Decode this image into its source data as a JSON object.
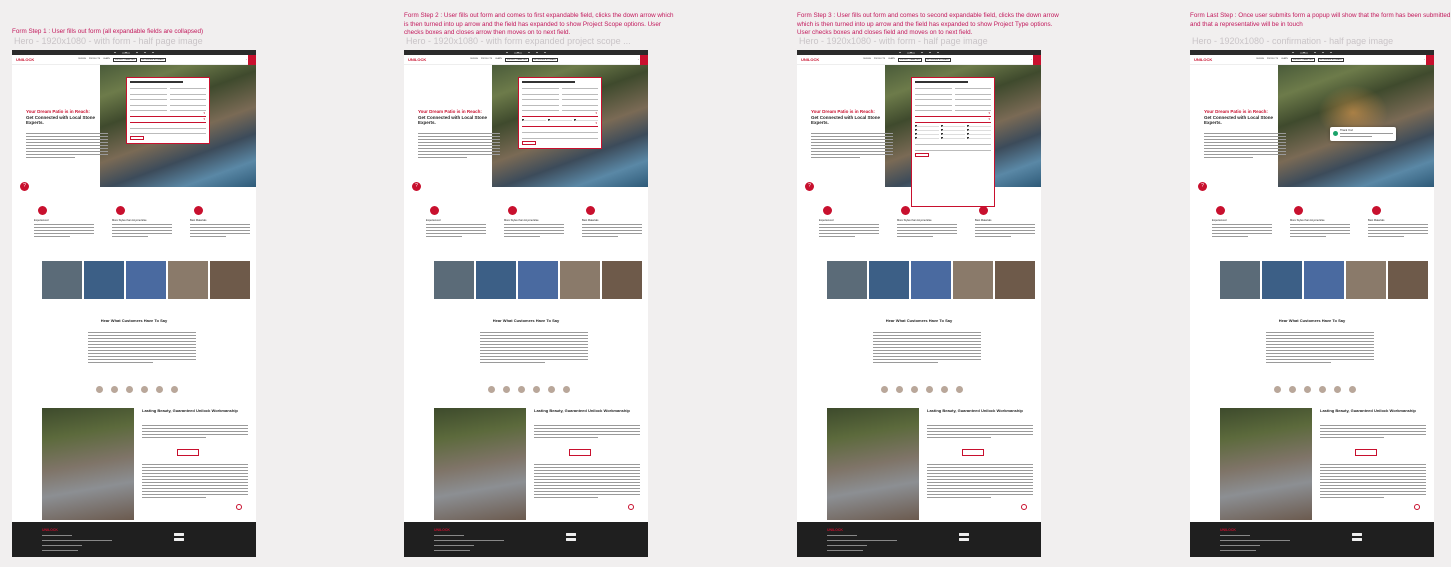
{
  "captions": [
    {
      "step": "Form Step 1 : User fills out form (all expandable fields are collapsed)",
      "sub": "Hero - 1920x1080 - with form - half page image"
    },
    {
      "step": "Form Step 2 : User fills out form and comes to first expandable field, clicks the down arrow which is then turned into up arrow and the field has expanded to show Project Scope options. User checks boxes and closes arrow then moves on to next field.",
      "sub": "Hero - 1920x1080 - with form expanded project scope ..."
    },
    {
      "step": "Form Step 3 : User fills out form and comes to second expandable field, clicks the down arrow which is then turned into up arrow and the field has expanded to show Project Type options. User checks boxes and closes field and moves on to next field.",
      "sub": "Hero - 1920x1080 - with form - half page image"
    },
    {
      "step": "Form Last Step : Once user submits form a popup will show that the form has been submitted and that a representative will be in touch",
      "sub": "Hero - 1920x1080 - confirmation - half page image"
    }
  ],
  "site": {
    "logo": "UNILOCK",
    "nav": [
      "DESIGN",
      "PRODUCTS",
      "LEARN",
      "PRODUCT SAMPLES",
      "GET A FREE ESTIMATE"
    ],
    "hero_title_red": "Your Dream Patio is in Reach:",
    "hero_title": "Get Connected with Local Stone Experts.",
    "features": [
      "Experienced",
      "More Styles than Anyone Else",
      "Best Materials"
    ],
    "testimonials_title": "Hear What Customers Have To Say",
    "lasting_title": "Lasting Beauty, Guaranteed Unilock Workmanship",
    "popup_title": "Thank You!"
  },
  "colors": {
    "brand": "#c8102e",
    "caption": "#c2185b",
    "footer": "#1f1f1f"
  }
}
